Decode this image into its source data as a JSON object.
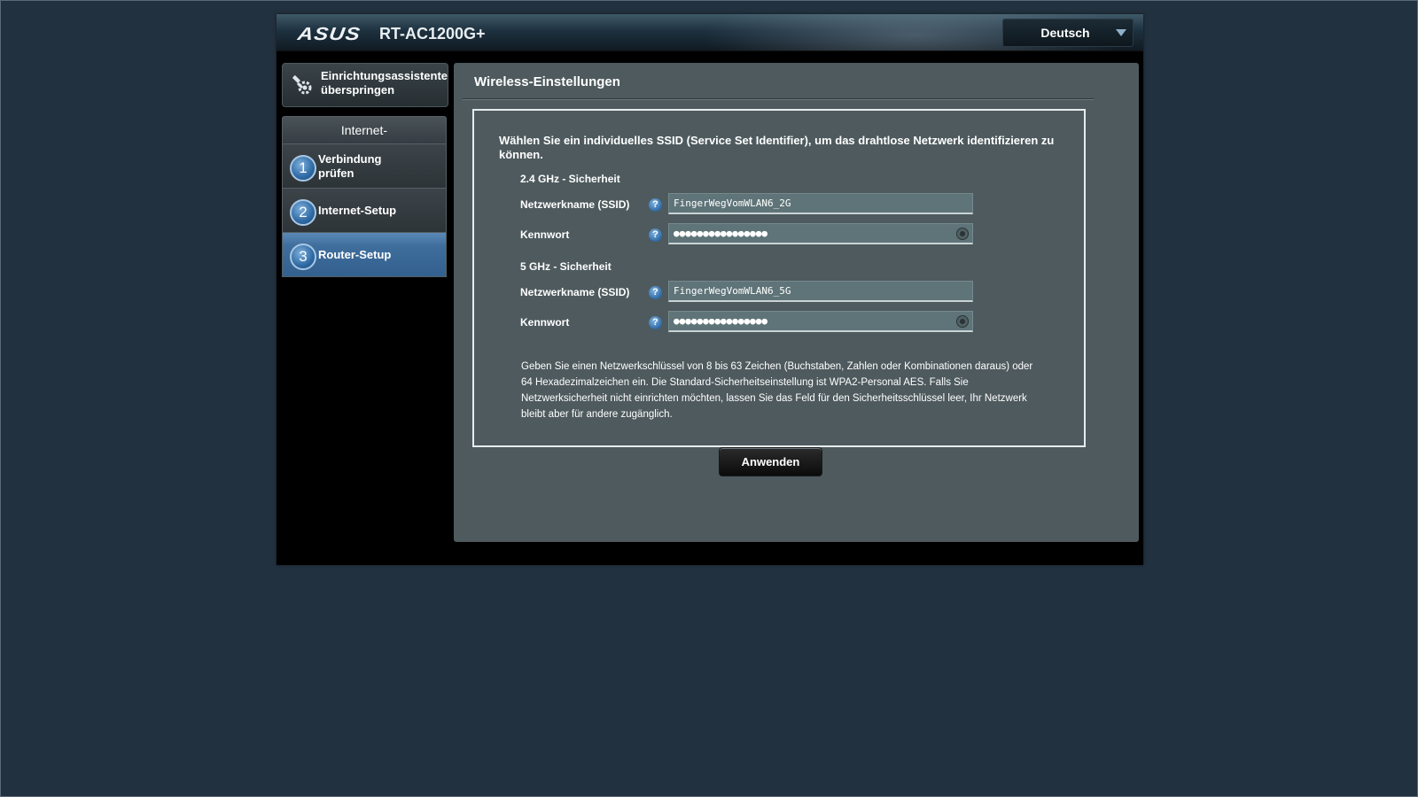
{
  "header": {
    "logo": "ASUS",
    "model": "RT-AC1200G+",
    "language": "Deutsch"
  },
  "sidebar": {
    "skip": {
      "line1": "Einrichtungsassistenten",
      "line2": "überspringen"
    },
    "steps_title": "Internet-",
    "steps": [
      {
        "num": "1",
        "line1": "Verbindung",
        "line2": "prüfen"
      },
      {
        "num": "2",
        "line1": "Internet-Setup",
        "line2": ""
      },
      {
        "num": "3",
        "line1": "Router-Setup",
        "line2": ""
      }
    ],
    "active_step": 3
  },
  "main": {
    "title": "Wireless-Einstellungen",
    "intro": "Wählen Sie ein individuelles SSID (Service Set Identifier), um das drahtlose Netzwerk identifizieren zu können.",
    "band_24": {
      "heading": "2.4 GHz - Sicherheit",
      "ssid_label": "Netzwerkname (SSID)",
      "ssid_value": "FingerWegVomWLAN6_2G",
      "password_label": "Kennwort",
      "password_value": "●●●●●●●●●●●●●●●●"
    },
    "band_5": {
      "heading": "5 GHz - Sicherheit",
      "ssid_label": "Netzwerkname (SSID)",
      "ssid_value": "FingerWegVomWLAN6_5G",
      "password_label": "Kennwort",
      "password_value": "●●●●●●●●●●●●●●●●"
    },
    "help_glyph": "?",
    "note": "Geben Sie einen Netzwerkschlüssel von 8 bis 63 Zeichen (Buchstaben, Zahlen oder Kombinationen daraus) oder 64 Hexadezimalzeichen ein. Die Standard-Sicherheitseinstellung ist WPA2-Personal AES. Falls Sie Netzwerksicherheit nicht einrichten möchten, lassen Sie das Feld für den Sicherheitsschlüssel leer, Ihr Netzwerk bleibt aber für andere zugänglich.",
    "apply_label": "Anwenden"
  },
  "colors": {
    "page_background": "#22313f",
    "panel_background": "#4e5a5e",
    "active_step": "#3f6e9c",
    "input_background": "#5f7478"
  },
  "icons": {
    "skip": "wrench-gear-icon",
    "help": "help-icon",
    "reveal": "eye-icon",
    "language": "chevron-down-icon"
  }
}
